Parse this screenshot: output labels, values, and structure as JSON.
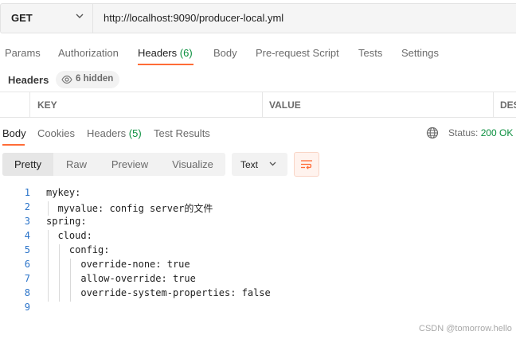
{
  "request": {
    "method": "GET",
    "url": "http://localhost:9090/producer-local.yml"
  },
  "request_tabs": [
    {
      "label": "Params"
    },
    {
      "label": "Authorization"
    },
    {
      "label": "Headers",
      "count": "(6)"
    },
    {
      "label": "Body"
    },
    {
      "label": "Pre-request Script"
    },
    {
      "label": "Tests"
    },
    {
      "label": "Settings"
    }
  ],
  "headers_section": {
    "title": "Headers",
    "hidden_label": "6 hidden",
    "columns": [
      "KEY",
      "VALUE",
      "DES"
    ]
  },
  "response_tabs": [
    {
      "label": "Body"
    },
    {
      "label": "Cookies"
    },
    {
      "label": "Headers",
      "count": "(5)"
    },
    {
      "label": "Test Results"
    }
  ],
  "status": {
    "label": "Status:",
    "value": "200 OK"
  },
  "view_modes": [
    "Pretty",
    "Raw",
    "Preview",
    "Visualize"
  ],
  "format": "Text",
  "icons": {
    "method_dropdown": "chevron-down-icon",
    "hidden_headers": "eye-icon",
    "network": "globe-icon",
    "format_dropdown": "chevron-down-icon",
    "wrap": "wrap-lines-icon"
  },
  "colors": {
    "accent": "#ff6c37",
    "success": "#0a8f3e",
    "line_numbers": "#2a73c9"
  },
  "code": {
    "line_numbers": [
      "1",
      "2",
      "3",
      "4",
      "5",
      "6",
      "7",
      "8",
      "9"
    ],
    "lines": [
      "mykey:",
      "  myvalue: config server的文件",
      "spring:",
      "  cloud:",
      "    config:",
      "      override-none: true",
      "      allow-override: true",
      "      override-system-properties: false",
      ""
    ]
  },
  "watermark": "CSDN @tomorrow.hello"
}
